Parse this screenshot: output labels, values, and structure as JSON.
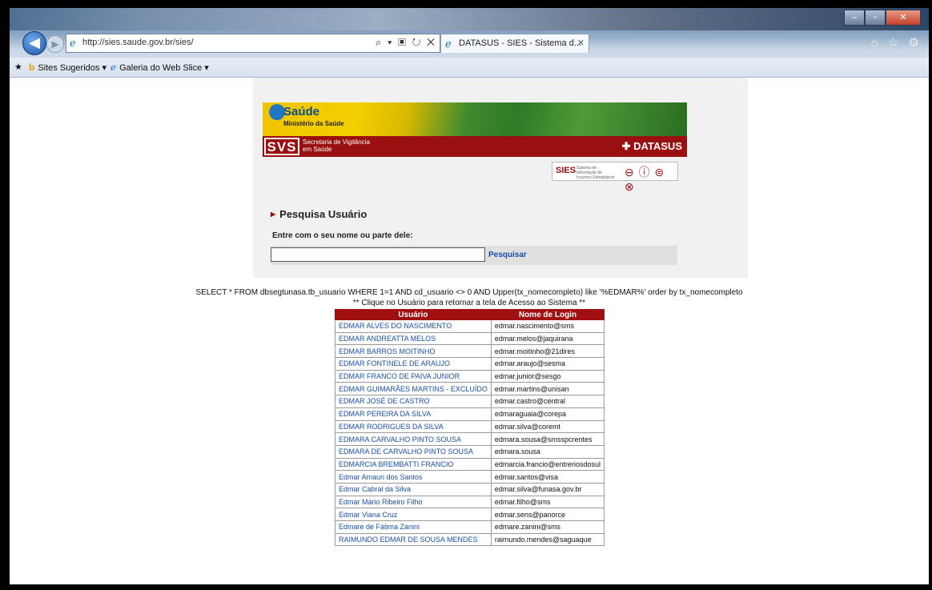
{
  "browser": {
    "url": "http://sies.saude.gov.br/sies/",
    "address_tools": "⌕ ▾ ▣ ↻ ✕",
    "tab_title": "DATASUS - SIES - Sistema d...",
    "tab_close": "✕",
    "right_icons": "⌂ ☆ ⚙",
    "window_controls": {
      "minimize": "–",
      "maximize": "▫",
      "close": "✕"
    },
    "favorites": [
      {
        "label": "Sites Sugeridos ▾",
        "icon": "bing-icon"
      },
      {
        "label": "Galeria do Web Slice ▾",
        "icon": "ie-icon"
      }
    ]
  },
  "header": {
    "saude_title": "Saúde",
    "saude_sub": "Ministério da Saúde",
    "svs_logo": "SVS",
    "svs_sub": "Secretaria de Vigilância em Saúde",
    "datasus": "✚ DATASUS",
    "sies_title": "SIES",
    "sies_sub": "Sistema de Informação de Insumos Estratégicos",
    "sies_icons": "⊖ ⓘ ⊜ ⊗"
  },
  "search": {
    "section_title": "Pesquisa Usuário",
    "prompt": "Entre com o seu nome ou parte dele:",
    "input_value": "",
    "button_label": "Pesquisar"
  },
  "sql_text": "SELECT * FROM dbsegtunasa.tb_usuario WHERE 1=1 AND cd_usuario <> 0 AND Upper(tx_nomecompleto) like '%EDMAR%' order by tx_nomecompleto",
  "hint_text": "** Clique no Usuário para retornar a tela de Acesso ao Sistema **",
  "table": {
    "headers": [
      "Usuário",
      "Nome de Login"
    ],
    "rows": [
      [
        "EDMAR ALVES DO NASCIMENTO",
        "edmar.nascimento@sms"
      ],
      [
        "EDMAR ANDREATTA MELOS",
        "edmar.melos@jaquirana"
      ],
      [
        "EDMAR BARROS MOITINHO",
        "edmar.moitinho@21dires"
      ],
      [
        "EDMAR FONTINELE DE ARAUJO",
        "edmar.araujo@sesma"
      ],
      [
        "EDMAR FRANCO DE PAIVA JUNIOR",
        "edmar.junior@sesgo"
      ],
      [
        "EDMAR GUIMARÃES MARTINS - EXCLUÍDO",
        "edmar.martins@unisan"
      ],
      [
        "EDMAR JOSÉ DE CASTRO",
        "edmar.castro@central"
      ],
      [
        "EDMAR PEREIRA DA SILVA",
        "edmaraguaia@corepa"
      ],
      [
        "EDMAR RODRIGUES DA SILVA",
        "edmar.silva@coremt"
      ],
      [
        "EDMARA CARVALHO PINTO SOUSA",
        "edmara.sousa@smsspcrentes"
      ],
      [
        "EDMARA DE CARVALHO PINTO SOUSA",
        "edmara.sousa"
      ],
      [
        "EDMARCIA BREMBATTI FRANCIO",
        "edmarcia.francio@entreriosdosul"
      ],
      [
        "Edmar Amauri dos Santos",
        "edmar.santos@visa"
      ],
      [
        "Edmar Cabral da Silva",
        "edmar.silva@funasa.gov.br"
      ],
      [
        "Edmar Mário Ribeiro Filho",
        "edmar.filho@sms"
      ],
      [
        "Edmar Viana Cruz",
        "edmar.sens@panorce"
      ],
      [
        "Edmare de Fátima Zanini",
        "edmare.zanini@sms"
      ],
      [
        "RAIMUNDO EDMAR DE SOUSA MENDES",
        "raimundo.mendes@saguaque"
      ]
    ]
  }
}
